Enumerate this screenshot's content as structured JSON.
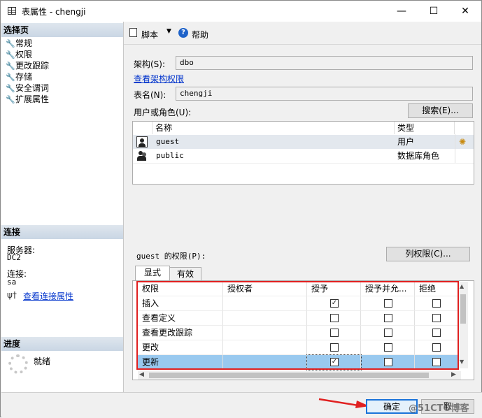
{
  "window": {
    "title": "表属性 - chengji",
    "minimize": "—",
    "maximize": "☐",
    "close": "✕"
  },
  "left": {
    "select_page_header": "选择页",
    "nav_items": [
      "常规",
      "权限",
      "更改跟踪",
      "存储",
      "安全谓词",
      "扩展属性"
    ],
    "connection_header": "连接",
    "server_label": "服务器:",
    "server_value": "DC2",
    "connection_label": "连接:",
    "connection_value": "sa",
    "view_connection_link": "查看连接属性",
    "progress_header": "进度",
    "progress_status": "就绪"
  },
  "toolbar": {
    "script_label": "脚本",
    "help_label": "帮助"
  },
  "form": {
    "schema_label": "架构(S):",
    "schema_value": "dbo",
    "view_schema_permissions_link": "查看架构权限",
    "table_name_label": "表名(N):",
    "table_name_value": "chengji",
    "users_roles_label": "用户或角色(U):",
    "search_button": "搜索(E)..."
  },
  "principals": {
    "columns": [
      "名称",
      "类型"
    ],
    "rows": [
      {
        "name": "guest",
        "type": "用户"
      },
      {
        "name": "public",
        "type": "数据库角色"
      }
    ]
  },
  "permissions": {
    "label": "guest 的权限(P):",
    "column_permissions_button": "列权限(C)...",
    "tabs": [
      "显式",
      "有效"
    ],
    "columns": [
      "权限",
      "授权者",
      "授予",
      "授予并允...",
      "拒绝"
    ],
    "rows": [
      {
        "name": "插入",
        "grantor": "",
        "grant": true,
        "with_grant": false,
        "deny": false
      },
      {
        "name": "查看定义",
        "grantor": "",
        "grant": false,
        "with_grant": false,
        "deny": false
      },
      {
        "name": "查看更改跟踪",
        "grantor": "",
        "grant": false,
        "with_grant": false,
        "deny": false
      },
      {
        "name": "更改",
        "grantor": "",
        "grant": false,
        "with_grant": false,
        "deny": false
      },
      {
        "name": "更新",
        "grantor": "",
        "grant": true,
        "with_grant": false,
        "deny": false
      }
    ]
  },
  "footer": {
    "ok_button": "确定",
    "cancel_partial": "取",
    "watermark": "@51CTO博客"
  },
  "colors": {
    "selection": "#99c9ef",
    "highlight_box": "#e02020",
    "link": "#0033cc",
    "header_gradient": "#c9d6e4"
  }
}
